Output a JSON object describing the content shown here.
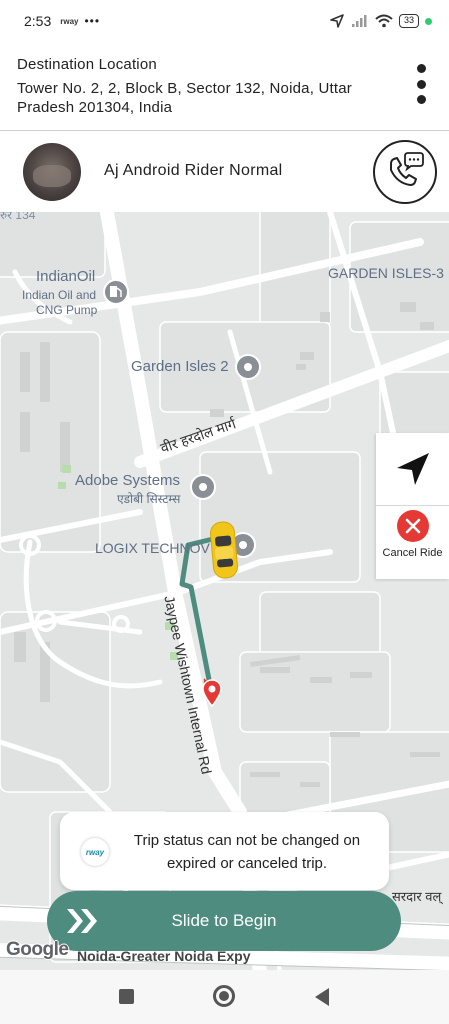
{
  "status_bar": {
    "time": "2:53",
    "app_indicator": "rway",
    "more": "•••",
    "battery": "33"
  },
  "destination": {
    "label": "Destination Location",
    "address": "Tower No. 2, 2, Block B, Sector 132, Noida, Uttar Pradesh 201304, India",
    "menu_icon": "kebab-menu-icon"
  },
  "rider": {
    "name": "Aj Android Rider Normal",
    "call_icon": "phone-chat-icon"
  },
  "map": {
    "labels": {
      "sector_fragment": "रुर 134",
      "indianoil_title": "IndianOil",
      "indianoil_sub1": "Indian Oil and",
      "indianoil_sub2": "CNG Pump",
      "garden_isles_3": "GARDEN ISLES-3",
      "garden_isles_2": "Garden Isles 2",
      "veer_hardol_marg": "वीर हरदोल मार्ग",
      "adobe_systems": "Adobe Systems",
      "adobe_systems_hindi": "एडोबी सिस्टम्स",
      "logix": "LOGIX TECHNOV",
      "jaypee_road": "Jaypee Wishtown Internal Rd",
      "sardar": "सरदार वल्",
      "expressway": "Noida-Greater Noida Expy"
    },
    "route_color": "#4f8c80",
    "destination_pin_color": "#e53935",
    "vehicle_color": "#f2c51b"
  },
  "side_panel": {
    "navigate_icon": "navigation-arrow-icon",
    "cancel_label": "Cancel Ride"
  },
  "toast": {
    "logo_text": "rway",
    "message": "Trip status can not be changed on expired or canceled trip."
  },
  "slider": {
    "label": "Slide to Begin",
    "color": "#4f8c80"
  },
  "attribution": "Google"
}
